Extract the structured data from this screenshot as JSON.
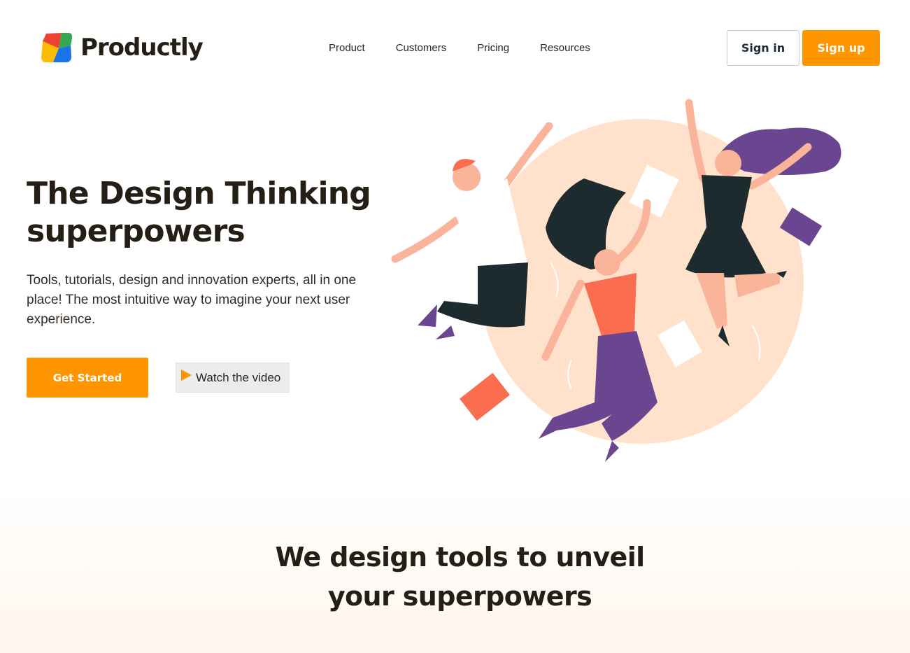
{
  "brand": {
    "name": "Productly",
    "logo_colors": [
      "#ea4335",
      "#34a853",
      "#fbbc05",
      "#1a73e8"
    ]
  },
  "nav": {
    "items": [
      {
        "label": "Product"
      },
      {
        "label": "Customers"
      },
      {
        "label": "Pricing"
      },
      {
        "label": "Resources"
      }
    ]
  },
  "auth": {
    "sign_in_label": "Sign in",
    "sign_up_label": "Sign up"
  },
  "hero": {
    "title": "The Design Thinking superpowers",
    "description": "Tools, tutorials, design and innovation experts, all in one place! The most intuitive way to imagine your next user experience.",
    "primary_cta": "Get Started",
    "secondary_cta": "Watch the video",
    "secondary_cta_icon": "play-icon"
  },
  "section_two": {
    "title_line_1": "We design tools to unveil",
    "title_line_2": "your superpowers"
  },
  "colors": {
    "accent": "#ff9500",
    "heading": "#241e14",
    "illustration_circle": "#ffe1cc",
    "purple": "#6b4690",
    "coral": "#fa6e4f",
    "dark": "#1d2a2e"
  }
}
